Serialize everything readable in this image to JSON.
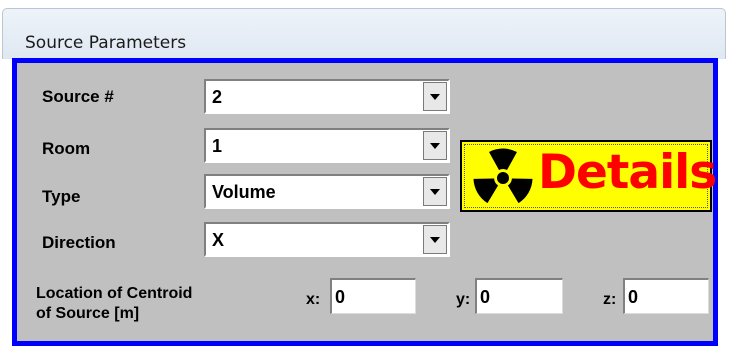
{
  "window": {
    "title": "Source Parameters"
  },
  "fields": [
    {
      "label": "Source #",
      "value": "2"
    },
    {
      "label": "Room",
      "value": "1"
    },
    {
      "label": "Type",
      "value": "Volume"
    },
    {
      "label": "Direction",
      "value": "X"
    }
  ],
  "details_button": {
    "label": "Details",
    "icon": "radiation-icon"
  },
  "location": {
    "label_line1": "Location of Centroid",
    "label_line2": "of Source  [m]",
    "x_label": "x:",
    "x_value": "0",
    "y_label": "y:",
    "y_value": "0",
    "z_label": "z:",
    "z_value": "0"
  },
  "colors": {
    "panel_bg": "#c0c0c0",
    "panel_border": "#0000ff",
    "details_bg": "#ffff00",
    "details_text": "#ff0000"
  }
}
